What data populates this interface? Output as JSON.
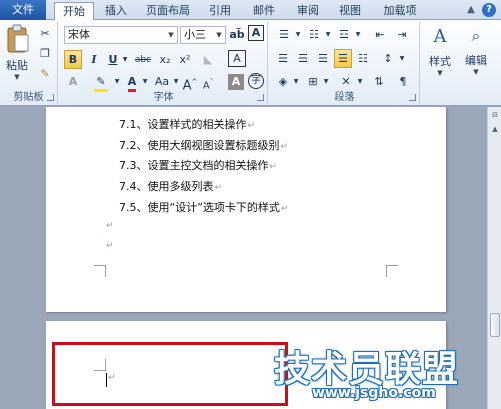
{
  "tabs": [
    {
      "label": "文件"
    },
    {
      "label": "开始"
    },
    {
      "label": "插入"
    },
    {
      "label": "页面布局"
    },
    {
      "label": "引用"
    },
    {
      "label": "邮件"
    },
    {
      "label": "审阅"
    },
    {
      "label": "视图"
    },
    {
      "label": "加载项"
    }
  ],
  "ribbon": {
    "clipboard": {
      "paste_label": "粘贴",
      "group_label": "剪贴板"
    },
    "font": {
      "font_name": "宋体",
      "font_size": "小三",
      "wen_label": "A",
      "group_label": "字体",
      "bold": "B",
      "italic": "I",
      "underline": "U",
      "strike": "abc",
      "sub": "x₂",
      "sup": "x²",
      "grow": "A",
      "shrink": "A",
      "case": "Aa",
      "clear": "A",
      "char_shade": "A",
      "circle": "字"
    },
    "paragraph": {
      "group_label": "段落"
    },
    "styles": {
      "label": "样式"
    },
    "editing": {
      "label": "编辑"
    }
  },
  "document": {
    "toc": [
      "7.1、设置样式的相关操作",
      "7.2、使用大纲视图设置标题级别",
      "7.3、设置主控文档的相关操作",
      "7.4、使用多级列表",
      "7.5、使用“设计”选项卡下的样式"
    ],
    "para_mark": "↵"
  },
  "watermark": {
    "logo": "技术员联盟",
    "url": "www.jsgho.com"
  },
  "colors": {
    "file_tab": "#2a62b4",
    "highlight": "#f7c94c",
    "red_box": "#c8101a",
    "watermark": "#1e6fb8"
  }
}
